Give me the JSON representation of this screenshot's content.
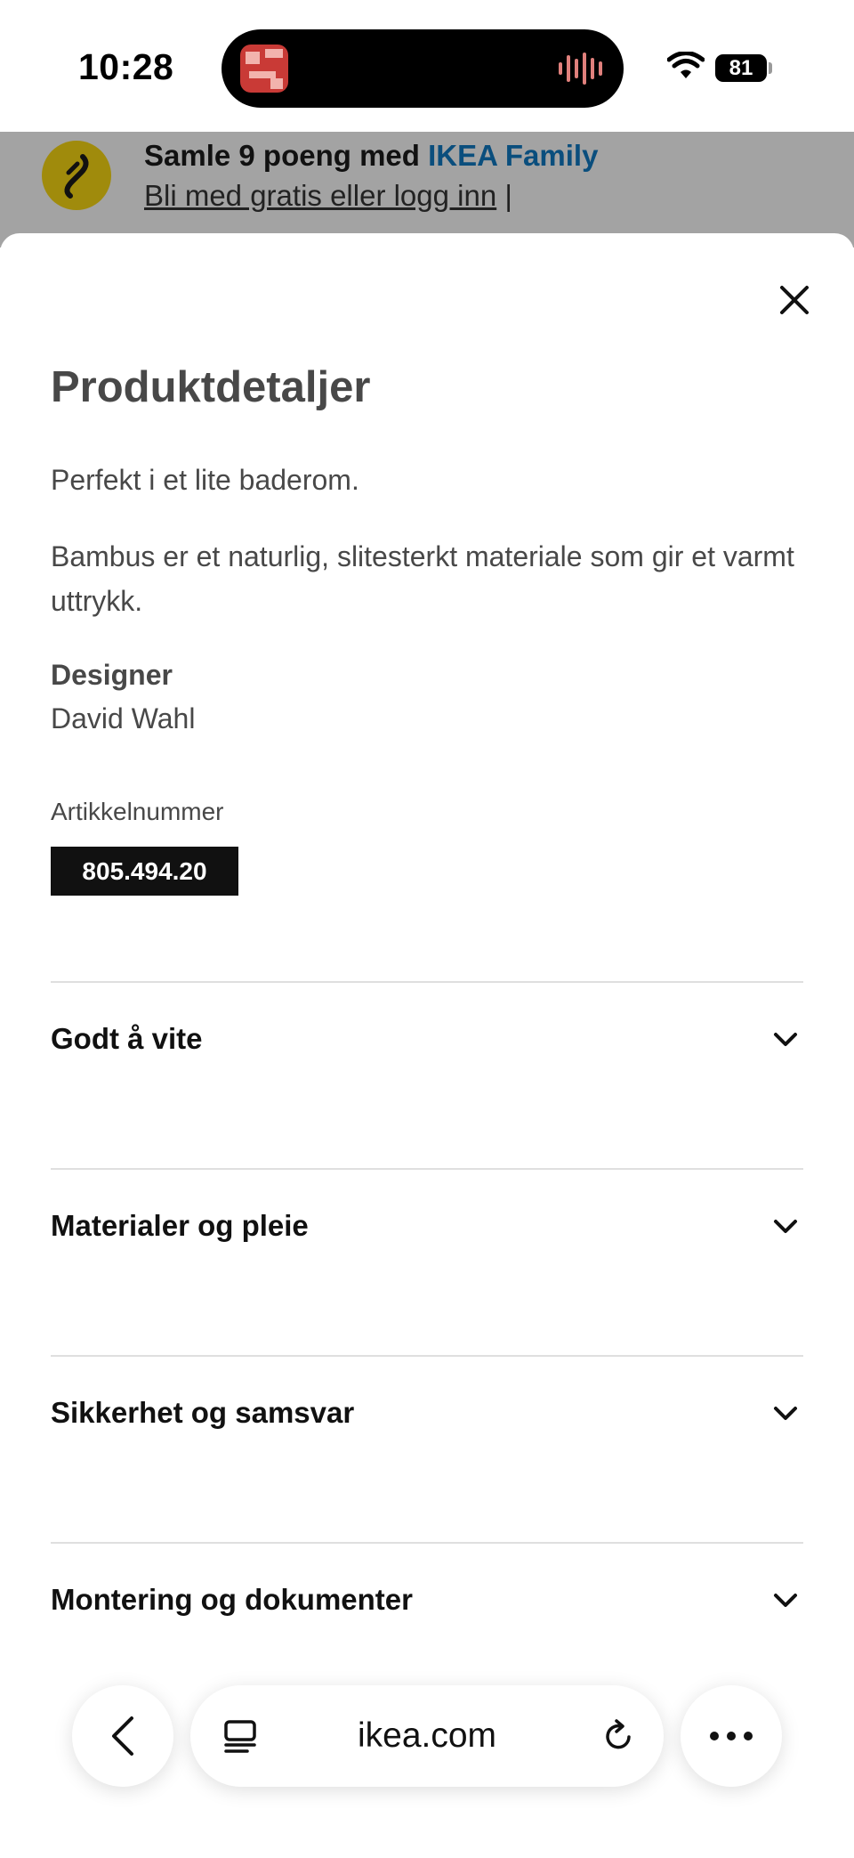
{
  "status_bar": {
    "time": "10:28",
    "battery": "81",
    "icons": [
      "now-playing-art-icon",
      "audio-waveform-icon",
      "wifi-icon",
      "battery-icon"
    ]
  },
  "promo": {
    "title_prefix": "Samle 9 poeng med ",
    "title_brand": "IKEA Family",
    "link": "Bli med gratis eller logg inn",
    "separator": " |",
    "brand_color": "#0a4e7d",
    "icon_color": "#a08b0c"
  },
  "panel": {
    "close_icon": "close-icon",
    "title": "Produktdetaljer",
    "description_1": "Perfekt i et lite baderom.",
    "description_2": "Bambus er et naturlig, slitesterkt materiale som gir et varmt uttrykk.",
    "designer_label": "Designer",
    "designer_name": "David Wahl",
    "article_label": "Artikkelnummer",
    "article_number": "805.494.20"
  },
  "accordion": [
    {
      "label": "Godt å vite"
    },
    {
      "label": "Materialer og pleie"
    },
    {
      "label": "Sikkerhet og samsvar"
    },
    {
      "label": "Montering og dokumenter"
    }
  ],
  "browser": {
    "url": "ikea.com",
    "icons": [
      "back-icon",
      "tabs-icon",
      "reload-icon",
      "more-icon"
    ]
  }
}
